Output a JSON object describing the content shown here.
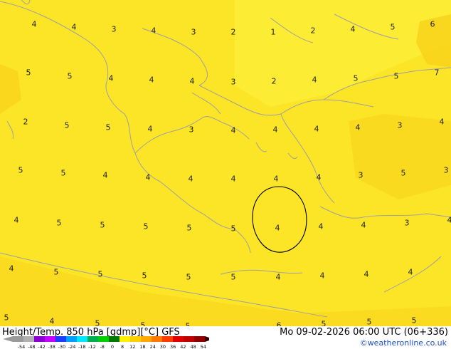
{
  "map": {
    "colors": {
      "base": "#fbe526",
      "lighter_band": "#fdf03a",
      "orange": "#f9d21a",
      "coast": "#a0a0a0",
      "contour": "#000000"
    },
    "values": [
      "4",
      "4",
      "3",
      "4",
      "3",
      "2",
      "1",
      "2",
      "4",
      "5",
      "6",
      "5",
      "5",
      "4",
      "4",
      "4",
      "3",
      "2",
      "4",
      "5",
      "5",
      "7",
      "2",
      "5",
      "5",
      "4",
      "3",
      "4",
      "4",
      "4",
      "4",
      "3",
      "4",
      "5",
      "5",
      "4",
      "4",
      "4",
      "4",
      "4",
      "4",
      "3",
      "5",
      "3",
      "4",
      "5",
      "5",
      "5",
      "5",
      "5",
      "4",
      "4",
      "4",
      "3",
      "4",
      "4",
      "5",
      "5",
      "5",
      "5",
      "5",
      "4",
      "4",
      "4",
      "4",
      "5",
      "4",
      "5",
      "5",
      "5",
      "6",
      "5",
      "5",
      "5"
    ]
  },
  "footer": {
    "title": "Height/Temp. 850 hPa [gdmp][°C] GFS",
    "datetime": "Mo 09-02-2026 06:00 UTC (06+336)",
    "credit": "©weatheronline.co.uk",
    "colorbar_labels": [
      "-54",
      "-48",
      "-42",
      "-38",
      "-30",
      "-24",
      "-18",
      "-12",
      "-8",
      "0",
      "8",
      "12",
      "18",
      "24",
      "30",
      "36",
      "42",
      "48",
      "54"
    ],
    "colorbar_colors": [
      "#9a9a9a",
      "#b0b0b0",
      "#8c00d6",
      "#c400ff",
      "#1e3cff",
      "#00a0ff",
      "#00e6ff",
      "#00b050",
      "#00d000",
      "#007a00",
      "#fff000",
      "#ffd000",
      "#ffa800",
      "#ff7800",
      "#ff3c00",
      "#e00000",
      "#c00000",
      "#900000"
    ]
  }
}
